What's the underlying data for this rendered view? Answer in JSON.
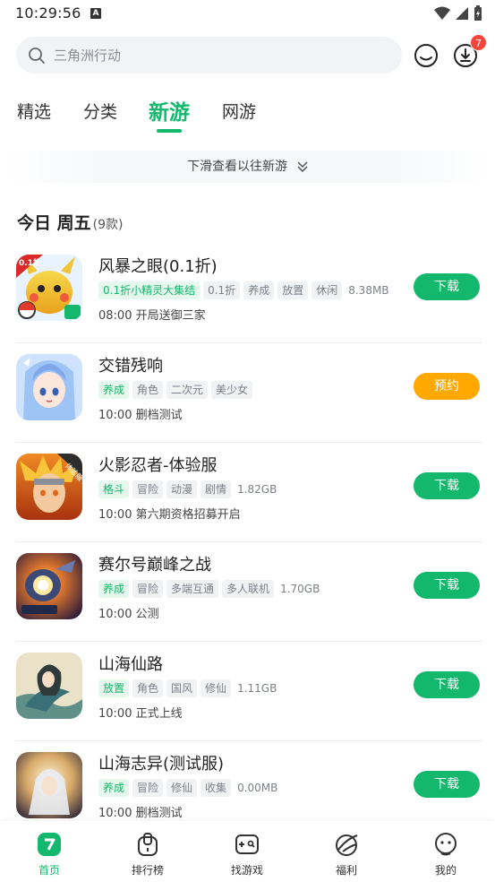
{
  "status": {
    "time": "10:29:56",
    "a_icon": "A"
  },
  "search": {
    "placeholder": "三角洲行动",
    "download_badge": "7"
  },
  "tabs": [
    {
      "label": "精选"
    },
    {
      "label": "分类"
    },
    {
      "label": "新游"
    },
    {
      "label": "网游"
    }
  ],
  "hint": {
    "text": "下滑查看以往新游"
  },
  "section": {
    "title": "今日 周五",
    "count": "(9款)"
  },
  "games": [
    {
      "name": "风暴之眼(0.1折)",
      "tags": [
        {
          "t": "0.1折小精灵大集结",
          "hl": true
        },
        {
          "t": "0.1折",
          "hl": false
        },
        {
          "t": "养成",
          "hl": false
        },
        {
          "t": "放置",
          "hl": false
        },
        {
          "t": "休闲",
          "hl": false
        }
      ],
      "size": "8.38MB",
      "sub": "08:00  开局送御三家",
      "action": "下载",
      "action_type": "dl"
    },
    {
      "name": "交错残响",
      "tags": [
        {
          "t": "养成",
          "hl": true
        },
        {
          "t": "角色",
          "hl": false
        },
        {
          "t": "二次元",
          "hl": false
        },
        {
          "t": "美少女",
          "hl": false
        }
      ],
      "size": "",
      "sub": "10:00  删档测试",
      "action": "预约",
      "action_type": "rsv"
    },
    {
      "name": "火影忍者-体验服",
      "tags": [
        {
          "t": "格斗",
          "hl": true
        },
        {
          "t": "冒险",
          "hl": false
        },
        {
          "t": "动漫",
          "hl": false
        },
        {
          "t": "剧情",
          "hl": false
        }
      ],
      "size": "1.82GB",
      "sub": "10:00  第六期资格招募开启",
      "action": "下载",
      "action_type": "dl"
    },
    {
      "name": "赛尔号巅峰之战",
      "tags": [
        {
          "t": "养成",
          "hl": true
        },
        {
          "t": "冒险",
          "hl": false
        },
        {
          "t": "多端互通",
          "hl": false
        },
        {
          "t": "多人联机",
          "hl": false
        }
      ],
      "size": "1.70GB",
      "sub": "10:00  公测",
      "action": "下载",
      "action_type": "dl"
    },
    {
      "name": "山海仙路",
      "tags": [
        {
          "t": "放置",
          "hl": true
        },
        {
          "t": "角色",
          "hl": false
        },
        {
          "t": "国风",
          "hl": false
        },
        {
          "t": "修仙",
          "hl": false
        }
      ],
      "size": "1.11GB",
      "sub": "10:00  正式上线",
      "action": "下载",
      "action_type": "dl"
    },
    {
      "name": "山海志异(测试服)",
      "tags": [
        {
          "t": "养成",
          "hl": true
        },
        {
          "t": "冒险",
          "hl": false
        },
        {
          "t": "修仙",
          "hl": false
        },
        {
          "t": "收集",
          "hl": false
        }
      ],
      "size": "0.00MB",
      "sub": "10:00  删档测试",
      "action": "下载",
      "action_type": "dl"
    }
  ],
  "nav": [
    {
      "label": "首页",
      "icon": "home-icon"
    },
    {
      "label": "排行榜",
      "icon": "ranking-icon"
    },
    {
      "label": "找游戏",
      "icon": "gamepad-icon"
    },
    {
      "label": "福利",
      "icon": "gift-icon"
    },
    {
      "label": "我的",
      "icon": "profile-icon"
    }
  ],
  "colors": {
    "accent": "#14b86c",
    "reserve": "#ffa800",
    "badge": "#f5463c"
  },
  "icon_text": {
    "game1_badge": "0.1折",
    "game3_badge": "体验服"
  }
}
